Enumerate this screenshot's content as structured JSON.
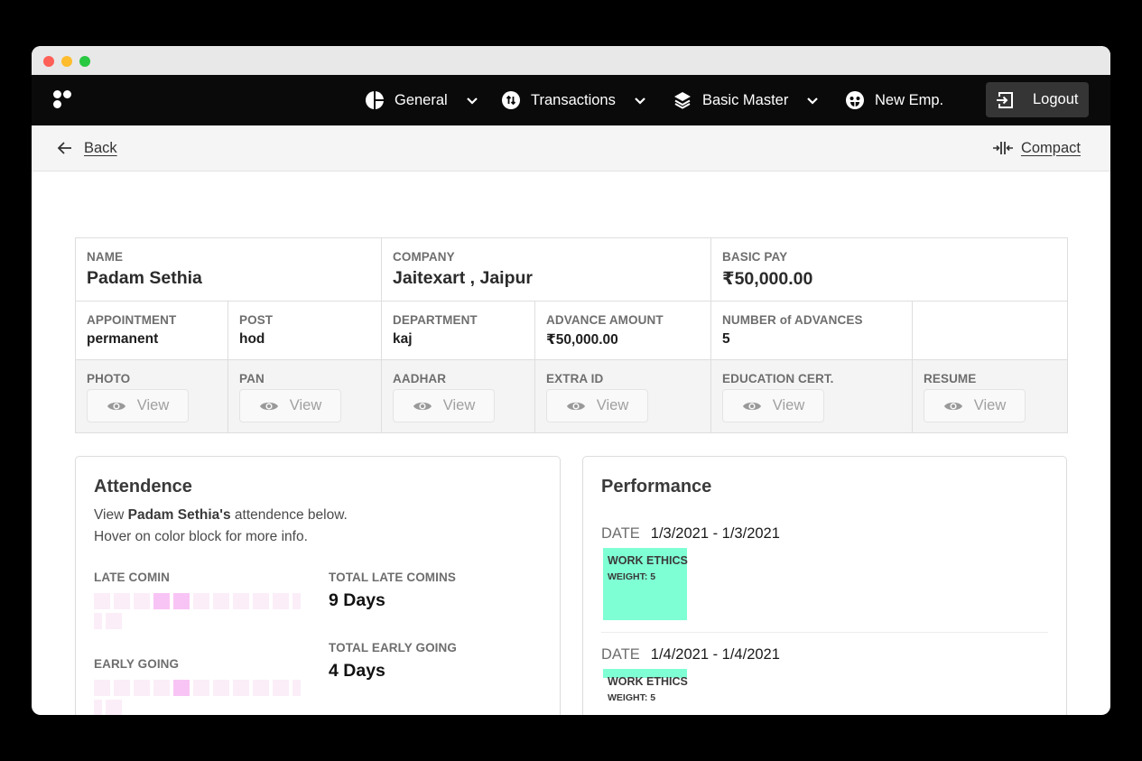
{
  "nav": {
    "items": [
      {
        "label": "General",
        "icon": "pie-chart-icon",
        "has_dropdown": true
      },
      {
        "label": "Transactions",
        "icon": "transfer-arrows-icon",
        "has_dropdown": true
      },
      {
        "label": "Basic Master",
        "icon": "layers-icon",
        "has_dropdown": true
      },
      {
        "label": "New Emp.",
        "icon": "face-icon",
        "has_dropdown": false
      }
    ],
    "logout_label": "Logout"
  },
  "subbar": {
    "back_label": "Back",
    "compact_label": "Compact"
  },
  "employee": {
    "name_label": "NAME",
    "name": "Padam Sethia",
    "company_label": "COMPANY",
    "company": "Jaitexart , Jaipur",
    "basic_pay_label": "BASIC PAY",
    "basic_pay": "₹50,000.00",
    "appointment_label": "APPOINTMENT",
    "appointment": "permanent",
    "post_label": "POST",
    "post": "hod",
    "department_label": "DEPARTMENT",
    "department": "kaj",
    "advance_amount_label": "ADVANCE AMOUNT",
    "advance_amount": "₹50,000.00",
    "num_advances_label": "NUMBER of ADVANCES",
    "num_advances": "5"
  },
  "documents": {
    "view_label": "View",
    "items": [
      "PHOTO",
      "PAN",
      "AADHAR",
      "EXTRA ID",
      "EDUCATION CERT.",
      "RESUME"
    ]
  },
  "attendance": {
    "title": "Attendence",
    "desc_prefix": "View ",
    "desc_name": "Padam Sethia's",
    "desc_suffix": " attendence below.",
    "hint": "Hover on color block for more info.",
    "late_comin": {
      "label": "LATE COMIN",
      "levels": [
        0,
        0,
        0,
        1,
        1,
        0,
        0,
        0,
        0,
        0,
        0,
        0
      ]
    },
    "early_going": {
      "label": "EARLY GOING",
      "levels": [
        0,
        0,
        0,
        0,
        1,
        0,
        0,
        0,
        0,
        0,
        0,
        0
      ]
    },
    "total_late_label": "TOTAL LATE COMINS",
    "total_late": "9 Days",
    "total_early_label": "TOTAL EARLY GOING",
    "total_early": "4 Days",
    "colors": {
      "level0": "#fbeef8",
      "level1": "#f8c4f5"
    }
  },
  "performance": {
    "title": "Performance",
    "date_label": "DATE",
    "items": [
      {
        "date": "1/3/2021 - 1/3/2021",
        "category": "WORK ETHICS",
        "weight": "WEIGHT: 5"
      },
      {
        "date": "1/4/2021 - 1/4/2021",
        "category": "WORK ETHICS",
        "weight": "WEIGHT: 5"
      }
    ],
    "block_color": "#7fffd4"
  }
}
